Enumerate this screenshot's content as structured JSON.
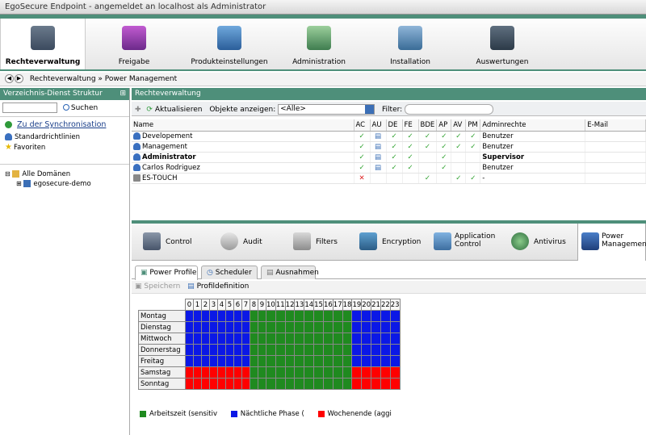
{
  "window": {
    "title": "EgoSecure Endpoint - angemeldet an localhost als Administrator"
  },
  "toolbar": {
    "items": [
      {
        "label": "Rechteverwaltung",
        "icon": "user-card-icon",
        "active": true
      },
      {
        "label": "Freigabe",
        "icon": "usb-drive-icon"
      },
      {
        "label": "Produkteinstellungen",
        "icon": "monitor-gear-icon"
      },
      {
        "label": "Administration",
        "icon": "checklist-gear-icon"
      },
      {
        "label": "Installation",
        "icon": "disc-install-icon"
      },
      {
        "label": "Auswertungen",
        "icon": "report-book-icon"
      }
    ]
  },
  "breadcrumb": {
    "text": "Rechteverwaltung » Power Management"
  },
  "left_panel": {
    "title": "Verzeichnis-Dienst Struktur",
    "search_button": "Suchen",
    "sync_link": "Zu der Synchronisation",
    "items": [
      {
        "label": "Standardrichtlinien",
        "icon": "users-icon"
      },
      {
        "label": "Favoriten",
        "icon": "star-icon"
      }
    ],
    "tree": [
      {
        "label": "Alle Domänen",
        "icon": "domain-folder-icon"
      },
      {
        "label": "egosecure-demo",
        "icon": "network-icon"
      }
    ]
  },
  "right_panel": {
    "title": "Rechteverwaltung",
    "refresh_button": "Aktualisieren",
    "objects_label": "Objekte anzeigen:",
    "objects_value": "<Alle>",
    "filter_label": "Filter:"
  },
  "user_table": {
    "columns": [
      "Name",
      "AC",
      "AU",
      "DE",
      "FE",
      "BDE",
      "AP",
      "AV",
      "PM",
      "Adminrechte",
      "E-Mail"
    ],
    "rows": [
      {
        "name": "Developement",
        "bold": false,
        "flags": [
          "ok",
          "doc",
          "ok",
          "ok",
          "ok",
          "ok",
          "ok",
          "ok"
        ],
        "admin": "Benutzer",
        "admin_bold": false,
        "email": ""
      },
      {
        "name": "Management",
        "bold": false,
        "flags": [
          "ok",
          "doc",
          "ok",
          "ok",
          "ok",
          "ok",
          "ok",
          "ok"
        ],
        "admin": "Benutzer",
        "admin_bold": false,
        "email": ""
      },
      {
        "name": "Administrator",
        "bold": true,
        "flags": [
          "ok",
          "doc",
          "ok",
          "ok",
          "",
          "ok",
          "",
          ""
        ],
        "admin": "Supervisor",
        "admin_bold": true,
        "email": ""
      },
      {
        "name": "Carlos Rodriguez",
        "bold": false,
        "flags": [
          "ok",
          "doc",
          "ok",
          "ok",
          "",
          "ok",
          "",
          ""
        ],
        "admin": "Benutzer",
        "admin_bold": false,
        "email": ""
      },
      {
        "name": "ES-TOUCH",
        "bold": false,
        "flags": [
          "x",
          "",
          "",
          "",
          "ok",
          "",
          "ok",
          "ok"
        ],
        "admin": "-",
        "admin_bold": false,
        "email": ""
      }
    ]
  },
  "modules": [
    {
      "label": "Control",
      "icon": "control-icon"
    },
    {
      "label": "Audit",
      "icon": "audit-magnifier-icon"
    },
    {
      "label": "Filters",
      "icon": "funnel-icon"
    },
    {
      "label": "Encryption",
      "icon": "lock-disk-icon"
    },
    {
      "label": "Application Control",
      "icon": "app-control-icon"
    },
    {
      "label": "Antivirus",
      "icon": "antivirus-icon"
    },
    {
      "label": "Power Management",
      "icon": "power-tower-icon",
      "active": true
    }
  ],
  "tabs": [
    {
      "label": "Power Profile",
      "active": true
    },
    {
      "label": "Scheduler",
      "active": false
    },
    {
      "label": "Ausnahmen",
      "active": false
    }
  ],
  "actions": {
    "save": "Speichern",
    "profile": "Profildefinition"
  },
  "schedule": {
    "hours": [
      "0",
      "1",
      "2",
      "3",
      "4",
      "5",
      "6",
      "7",
      "8",
      "9",
      "10",
      "11",
      "12",
      "13",
      "14",
      "15",
      "16",
      "17",
      "18",
      "19",
      "20",
      "21",
      "22",
      "23"
    ],
    "days": [
      {
        "label": "Montag",
        "cells": "BBBBBBBBGGGGGGGGGGGBBBBB"
      },
      {
        "label": "Dienstag",
        "cells": "BBBBBBBBGGGGGGGGGGGBBBBB"
      },
      {
        "label": "Mittwoch",
        "cells": "BBBBBBBBGGGGGGGGGGGBBBBB"
      },
      {
        "label": "Donnerstag",
        "cells": "BBBBBBBBGGGGGGGGGGGBBBBB"
      },
      {
        "label": "Freitag",
        "cells": "BBBBBBBBGGGGGGGGGGGBBBBB"
      },
      {
        "label": "Samstag",
        "cells": "RRRRRRRRGGGGGGGGGGGRRRRR"
      },
      {
        "label": "Sonntag",
        "cells": "RRRRRRRRGGGGGGGGGGGRRRRR"
      }
    ],
    "colors": {
      "G": "#1f8a1f",
      "B": "#0b18e6",
      "R": "#ff0000"
    }
  },
  "legend": [
    {
      "label": "Arbeitszeit (sensitiv",
      "color": "#1f8a1f"
    },
    {
      "label": "Nächtliche Phase (",
      "color": "#0b18e6"
    },
    {
      "label": "Wochenende (aggi",
      "color": "#ff0000"
    }
  ],
  "theme": {
    "accent": "#4e8f7a"
  }
}
